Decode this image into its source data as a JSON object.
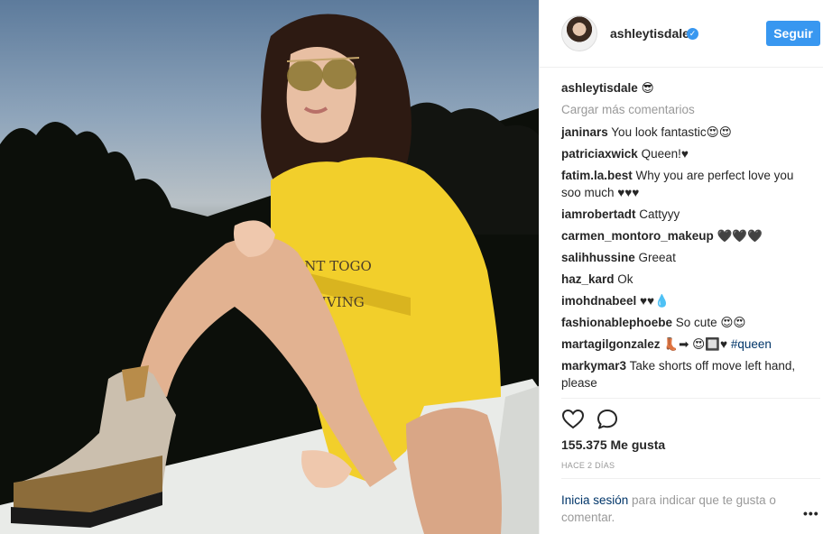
{
  "post": {
    "image_icon": "photo-of-woman-in-yellow-hoodie",
    "header": {
      "username": "ashleytisdale",
      "verified_icon": "verified-badge-icon",
      "follow_label": "Seguir"
    },
    "caption": {
      "username": "ashleytisdale",
      "text": "😎"
    },
    "load_more": "Cargar más comentarios",
    "comments": [
      {
        "user": "janinars",
        "text": "You look fantastic😍😍"
      },
      {
        "user": "patriciaxwick",
        "text": "Queen!♥"
      },
      {
        "user": "fatim.la.best",
        "text": "Why you are perfect love you soo much ♥♥♥"
      },
      {
        "user": "iamrobertadt",
        "text": "Cattyyy"
      },
      {
        "user": "carmen_montoro_makeup",
        "text": "🖤🖤🖤"
      },
      {
        "user": "salihhussine",
        "text": "Greeat"
      },
      {
        "user": "haz_kard",
        "text": "Ok"
      },
      {
        "user": "imohdnabeel",
        "text": "♥♥💧"
      },
      {
        "user": "fashionablephoebe",
        "text": "So cute 😍😍"
      },
      {
        "user": "martagilgonzalez",
        "text": "👢➡ 😍🔲♥ ",
        "hashtag": "#queen"
      },
      {
        "user": "markymar3",
        "text": "Take shorts off move left hand, please"
      }
    ],
    "actions": {
      "like_icon": "heart-outline-icon",
      "comment_icon": "comment-bubble-icon"
    },
    "likes": "155.375 Me gusta",
    "time": "HACE 2 DÍAS",
    "login": {
      "link": "Inicia sesión",
      "text": " para indicar que te gusta o comentar."
    },
    "more_icon": "more-options-icon",
    "more_label": "•••"
  }
}
